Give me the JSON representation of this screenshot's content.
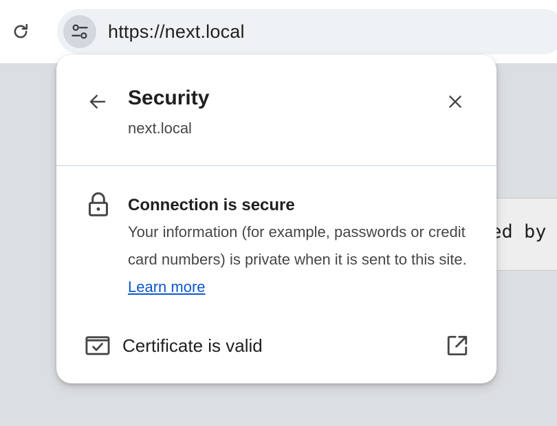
{
  "toolbar": {
    "reload_icon": "reload-icon",
    "site_info_icon": "tune-icon",
    "url": "https://next.local"
  },
  "page": {
    "code_snippet": "ted by"
  },
  "popup": {
    "title": "Security",
    "domain": "next.local",
    "back_icon": "arrow-left-icon",
    "close_icon": "close-icon",
    "connection": {
      "icon": "lock-icon",
      "title": "Connection is secure",
      "description": "Your information (for example, passwords or credit card numbers) is private when it is sent to this site.",
      "learn_more": "Learn more"
    },
    "certificate": {
      "icon": "certificate-icon",
      "label": "Certificate is valid",
      "action_icon": "open-in-new-icon"
    }
  },
  "colors": {
    "link": "#0b57d0",
    "divider": "#dbe6f3",
    "omnibox_bg": "#eff2f5",
    "site_info_bg": "#d3d8de",
    "page_bg": "#dcdfe2"
  }
}
